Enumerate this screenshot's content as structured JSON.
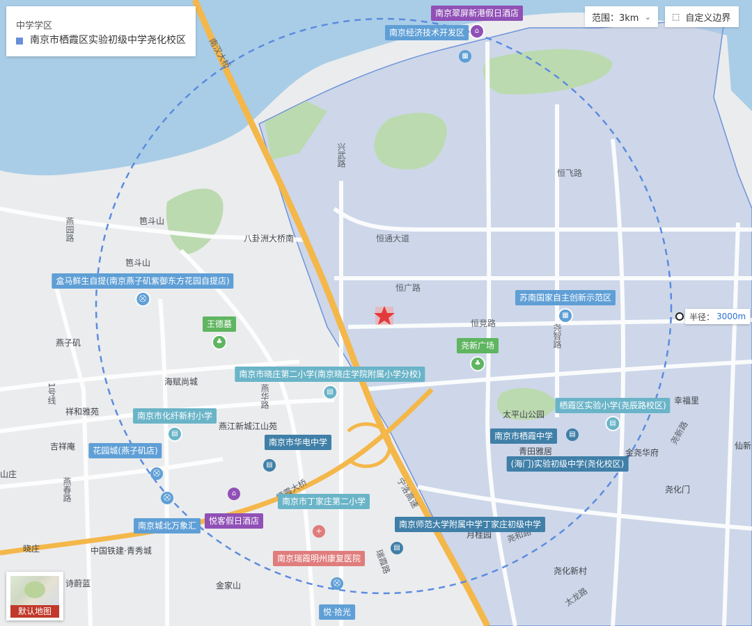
{
  "legend": {
    "title": "中学学区",
    "item": "南京市栖霞区实验初级中学尧化校区",
    "color": "#6a8fd8"
  },
  "controls": {
    "range_label": "范围：3km",
    "custom_border_label": "自定义边界"
  },
  "radius": {
    "label": "半径：",
    "value": "3000m"
  },
  "minimap": {
    "label": "默认地图"
  },
  "map_text": {
    "nanjing_bridge": "南汉大桥",
    "xingwu_road": "兴武路",
    "hengfei_road": "恒飞路",
    "hengtong_ave": "恒通大道",
    "hengguang_road": "恒广路",
    "hengjing_road": "恒竞路",
    "yaozhi_road": "尧智路",
    "baguazhou": "八卦洲大桥南",
    "paodou_shan1": "笆斗山",
    "paodou_shan2": "笆斗山",
    "yanyuan_road": "燕园路",
    "yanziji": "燕子矶",
    "haifu": "海赋尚城",
    "xiangheya": "祥和雅苑",
    "jixiangan": "吉祥庵",
    "line1": "1号线",
    "yanjiang": "燕江新城江山苑",
    "taipingshan": "太平山公园",
    "qingtian": "青田雅居",
    "xingfuli": "幸福里",
    "jinhuafu": "金尧华府",
    "yaohuamen": "尧化门",
    "xianlin": "仙新",
    "yaohua_xincun": "尧化新村",
    "yueguiyuan": "月桂园",
    "yaohe_road": "尧和路",
    "xiaozhuang": "晓庄",
    "tiejian": "中国铁建·青秀城",
    "shiweilan": "诗蔚蓝",
    "jinjiashan": "金家山",
    "ninglu_gaosu": "宁洛高速",
    "jingxia_road": "瑞霞路",
    "yanchun_road": "燕春路",
    "daolu2": "燕华路",
    "qiao": "栖霞大桥",
    "shanzhuang": "山庄",
    "tailong_road": "太龙路",
    "yaoxin_road": "尧新路"
  },
  "pois": [
    {
      "name": "南京翠屏新港假日酒店",
      "color": "purple",
      "icon": "hotel-icon"
    },
    {
      "name": "南京经济技术开发区",
      "color": "blue",
      "icon": "gov-icon"
    },
    {
      "name": "盒马鲜生自提(南京燕子矶紫御东方花园自提店)",
      "color": "blue",
      "icon": "shop-icon"
    },
    {
      "name": "王德墓",
      "color": "green",
      "icon": "tree-icon"
    },
    {
      "name": "苏南国家自主创新示范区",
      "color": "blue",
      "icon": "gov-icon"
    },
    {
      "name": "尧新广场",
      "color": "green",
      "icon": "tree-icon"
    },
    {
      "name": "南京市晓庄第二小学(南京晓庄学院附属小学分校)",
      "color": "teal",
      "icon": "school-icon"
    },
    {
      "name": "南京市化纤新村小学",
      "color": "teal",
      "icon": "school-icon"
    },
    {
      "name": "栖霞区实验小学(尧辰路校区)",
      "color": "teal",
      "icon": "school-icon"
    },
    {
      "name": "南京市栖霞中学",
      "color": "navy",
      "icon": "school-icon"
    },
    {
      "name": "(海门)实验初级中学(尧化校区)",
      "color": "navy",
      "icon": "school-icon"
    },
    {
      "name": "花园城(燕子矶店)",
      "color": "blue",
      "icon": "shop-icon"
    },
    {
      "name": "南京市华电中学",
      "color": "navy",
      "icon": "school-icon"
    },
    {
      "name": "南京市丁家庄第二小学",
      "color": "teal",
      "icon": "school-icon"
    },
    {
      "name": "南京城北万象汇",
      "color": "blue",
      "icon": "shop-icon"
    },
    {
      "name": "悦客假日酒店",
      "color": "purple",
      "icon": "hotel-icon"
    },
    {
      "name": "南京瑞霞明州康复医院",
      "color": "pink",
      "icon": "hospital-icon"
    },
    {
      "name": "南京师范大学附属中学丁家庄初级中学",
      "color": "navy",
      "icon": "school-icon"
    },
    {
      "name": "悦·拾光",
      "color": "blue",
      "icon": "shop-icon"
    }
  ]
}
